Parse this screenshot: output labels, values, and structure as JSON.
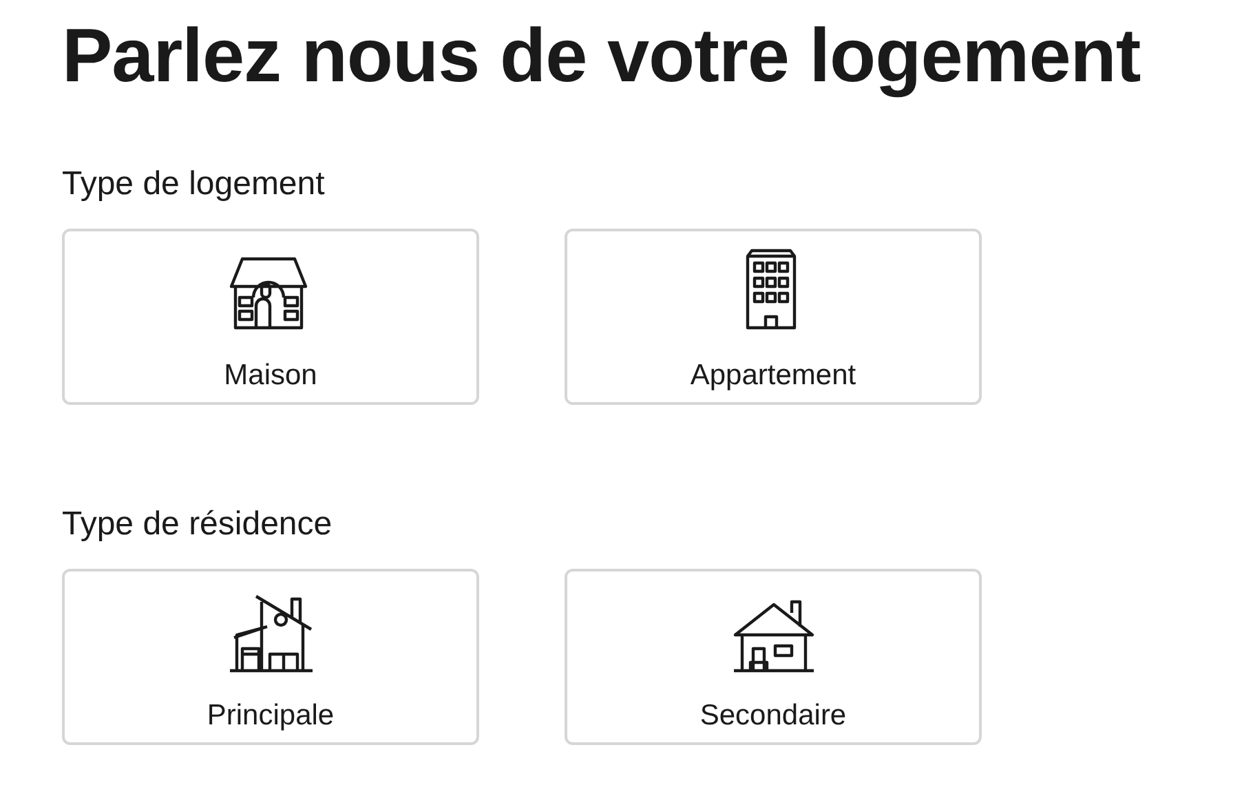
{
  "title": "Parlez nous de votre logement",
  "sections": [
    {
      "label": "Type de logement",
      "options": [
        {
          "label": "Maison",
          "kind": "manor"
        },
        {
          "label": "Appartement",
          "kind": "tower"
        }
      ]
    },
    {
      "label": "Type de résidence",
      "options": [
        {
          "label": "Principale",
          "kind": "modern"
        },
        {
          "label": "Secondaire",
          "kind": "cottage"
        }
      ]
    }
  ]
}
